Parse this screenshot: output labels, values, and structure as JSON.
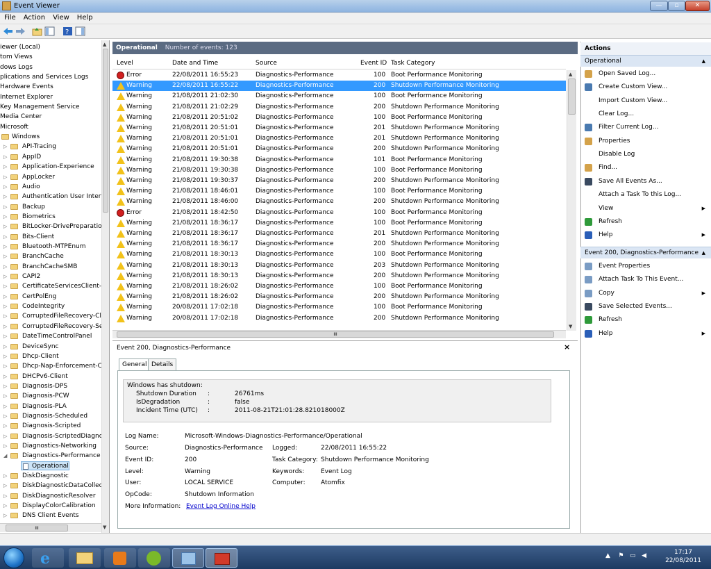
{
  "window": {
    "title": "Event Viewer"
  },
  "menu": [
    "File",
    "Action",
    "View",
    "Help"
  ],
  "tree": {
    "top_items": [
      "iewer (Local)",
      "tom Views",
      "dows Logs",
      "plications and Services Logs",
      "Hardware Events",
      "Internet Explorer",
      "Key Management Service",
      "Media Center",
      "Microsoft"
    ],
    "windows_label": "Windows",
    "folders": [
      "API-Tracing",
      "AppID",
      "Application-Experience",
      "AppLocker",
      "Audio",
      "Authentication User Interfa",
      "Backup",
      "Biometrics",
      "BitLocker-DrivePreparation",
      "Bits-Client",
      "Bluetooth-MTPEnum",
      "BranchCache",
      "BranchCacheSMB",
      "CAPI2",
      "CertificateServicesClient-C",
      "CertPolEng",
      "CodeIntegrity",
      "CorruptedFileRecovery-Cli",
      "CorruptedFileRecovery-Se",
      "DateTimeControlPanel",
      "DeviceSync",
      "Dhcp-Client",
      "Dhcp-Nap-Enforcement-C",
      "DHCPv6-Client",
      "Diagnosis-DPS",
      "Diagnosis-PCW",
      "Diagnosis-PLA",
      "Diagnosis-Scheduled",
      "Diagnosis-Scripted",
      "Diagnosis-ScriptedDiagno",
      "Diagnostics-Networking",
      "Diagnostics-Performance"
    ],
    "selected_child": "Operational",
    "after_folders": [
      "DiskDiagnostic",
      "DiskDiagnosticDataCollect",
      "DiskDiagnosticResolver",
      "DisplayColorCalibration",
      "DNS Client Events"
    ],
    "hscroll_glyph": "III"
  },
  "center": {
    "title": "Operational",
    "count_label": "Number of events: 123",
    "columns": [
      "Level",
      "Date and Time",
      "Source",
      "Event ID",
      "Task Category"
    ],
    "rows": [
      {
        "level": "Error",
        "date": "22/08/2011 16:55:23",
        "source": "Diagnostics-Performance",
        "id": "100",
        "task": "Boot Performance Monitoring"
      },
      {
        "level": "Warning",
        "date": "22/08/2011 16:55:22",
        "source": "Diagnostics-Performance",
        "id": "200",
        "task": "Shutdown Performance Monitoring",
        "selected": true
      },
      {
        "level": "Warning",
        "date": "21/08/2011 21:02:30",
        "source": "Diagnostics-Performance",
        "id": "100",
        "task": "Boot Performance Monitoring"
      },
      {
        "level": "Warning",
        "date": "21/08/2011 21:02:29",
        "source": "Diagnostics-Performance",
        "id": "200",
        "task": "Shutdown Performance Monitoring"
      },
      {
        "level": "Warning",
        "date": "21/08/2011 20:51:02",
        "source": "Diagnostics-Performance",
        "id": "100",
        "task": "Boot Performance Monitoring"
      },
      {
        "level": "Warning",
        "date": "21/08/2011 20:51:01",
        "source": "Diagnostics-Performance",
        "id": "201",
        "task": "Shutdown Performance Monitoring"
      },
      {
        "level": "Warning",
        "date": "21/08/2011 20:51:01",
        "source": "Diagnostics-Performance",
        "id": "201",
        "task": "Shutdown Performance Monitoring"
      },
      {
        "level": "Warning",
        "date": "21/08/2011 20:51:01",
        "source": "Diagnostics-Performance",
        "id": "200",
        "task": "Shutdown Performance Monitoring"
      },
      {
        "level": "Warning",
        "date": "21/08/2011 19:30:38",
        "source": "Diagnostics-Performance",
        "id": "101",
        "task": "Boot Performance Monitoring"
      },
      {
        "level": "Warning",
        "date": "21/08/2011 19:30:38",
        "source": "Diagnostics-Performance",
        "id": "100",
        "task": "Boot Performance Monitoring"
      },
      {
        "level": "Warning",
        "date": "21/08/2011 19:30:37",
        "source": "Diagnostics-Performance",
        "id": "200",
        "task": "Shutdown Performance Monitoring"
      },
      {
        "level": "Warning",
        "date": "21/08/2011 18:46:01",
        "source": "Diagnostics-Performance",
        "id": "100",
        "task": "Boot Performance Monitoring"
      },
      {
        "level": "Warning",
        "date": "21/08/2011 18:46:00",
        "source": "Diagnostics-Performance",
        "id": "200",
        "task": "Shutdown Performance Monitoring"
      },
      {
        "level": "Error",
        "date": "21/08/2011 18:42:50",
        "source": "Diagnostics-Performance",
        "id": "100",
        "task": "Boot Performance Monitoring"
      },
      {
        "level": "Warning",
        "date": "21/08/2011 18:36:17",
        "source": "Diagnostics-Performance",
        "id": "100",
        "task": "Boot Performance Monitoring"
      },
      {
        "level": "Warning",
        "date": "21/08/2011 18:36:17",
        "source": "Diagnostics-Performance",
        "id": "201",
        "task": "Shutdown Performance Monitoring"
      },
      {
        "level": "Warning",
        "date": "21/08/2011 18:36:17",
        "source": "Diagnostics-Performance",
        "id": "200",
        "task": "Shutdown Performance Monitoring"
      },
      {
        "level": "Warning",
        "date": "21/08/2011 18:30:13",
        "source": "Diagnostics-Performance",
        "id": "100",
        "task": "Boot Performance Monitoring"
      },
      {
        "level": "Warning",
        "date": "21/08/2011 18:30:13",
        "source": "Diagnostics-Performance",
        "id": "203",
        "task": "Shutdown Performance Monitoring"
      },
      {
        "level": "Warning",
        "date": "21/08/2011 18:30:13",
        "source": "Diagnostics-Performance",
        "id": "200",
        "task": "Shutdown Performance Monitoring"
      },
      {
        "level": "Warning",
        "date": "21/08/2011 18:26:02",
        "source": "Diagnostics-Performance",
        "id": "100",
        "task": "Boot Performance Monitoring"
      },
      {
        "level": "Warning",
        "date": "21/08/2011 18:26:02",
        "source": "Diagnostics-Performance",
        "id": "200",
        "task": "Shutdown Performance Monitoring"
      },
      {
        "level": "Warning",
        "date": "20/08/2011 17:02:18",
        "source": "Diagnostics-Performance",
        "id": "100",
        "task": "Boot Performance Monitoring"
      },
      {
        "level": "Warning",
        "date": "20/08/2011 17:02:18",
        "source": "Diagnostics-Performance",
        "id": "200",
        "task": "Shutdown Performance Monitoring"
      }
    ],
    "hscroll_glyph": "III"
  },
  "detail": {
    "title": "Event 200, Diagnostics-Performance",
    "close": "×",
    "tabs": [
      "General",
      "Details"
    ],
    "message_title": "Windows has shutdown:",
    "message_lines": [
      {
        "k": "Shutdown Duration",
        "v": "26761ms"
      },
      {
        "k": "IsDegradation",
        "v": "false"
      },
      {
        "k": "Incident Time (UTC)",
        "v": "2011-08-21T21:01:28.821018000Z"
      }
    ],
    "colon": ":",
    "labels": {
      "log_name": "Log Name:",
      "source": "Source:",
      "event_id": "Event ID:",
      "level": "Level:",
      "user": "User:",
      "opcode": "OpCode:",
      "more_info": "More Information:",
      "logged": "Logged:",
      "task_category": "Task Category:",
      "keywords": "Keywords:",
      "computer": "Computer:"
    },
    "values": {
      "log_name": "Microsoft-Windows-Diagnostics-Performance/Operational",
      "source": "Diagnostics-Performance",
      "event_id": "200",
      "level": "Warning",
      "user": "LOCAL SERVICE",
      "opcode": "Shutdown Information",
      "more_info": "Event Log Online Help",
      "logged": "22/08/2011 16:55:22",
      "task_category": "Shutdown Performance Monitoring",
      "keywords": "Event Log",
      "computer": "Atomfix"
    }
  },
  "actions": {
    "header": "Actions",
    "section1": "Operational",
    "items1": [
      "Open Saved Log...",
      "Create Custom View...",
      "Import Custom View...",
      "Clear Log...",
      "Filter Current Log...",
      "Properties",
      "Disable Log",
      "Find...",
      "Save All Events As...",
      "Attach a Task To this Log...",
      "View",
      "Refresh",
      "Help"
    ],
    "section2": "Event 200, Diagnostics-Performance",
    "items2": [
      "Event Properties",
      "Attach Task To This Event...",
      "Copy",
      "Save Selected Events...",
      "Refresh",
      "Help"
    ]
  },
  "taskbar": {
    "time": "17:17",
    "date": "22/08/2011"
  },
  "colors": {
    "selection": "#3399ff",
    "header": "#5b6b82",
    "section": "#dbe6f4",
    "link": "#0000cc"
  }
}
